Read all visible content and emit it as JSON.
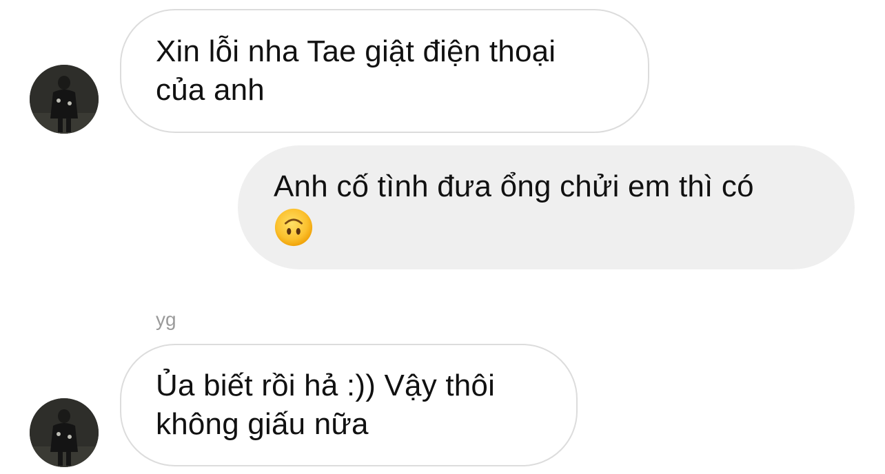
{
  "messages": [
    {
      "direction": "incoming",
      "lines": [
        "Xin lỗi nha Tae giật điện thoại",
        "của anh"
      ],
      "avatar_icon": "profile-photo-person-black-jacket"
    },
    {
      "direction": "outgoing",
      "lines": [
        "Anh cố tình đưa ổng chửi em thì có"
      ],
      "emoji": "upside-down-face"
    },
    {
      "direction": "incoming",
      "sender": "yg",
      "lines": [
        "Ủa biết rồi hả :)) Vậy thôi",
        "không giấu nữa"
      ],
      "avatar_icon": "profile-photo-person-black-jacket"
    }
  ],
  "colors": {
    "incoming_bubble_bg": "#ffffff",
    "incoming_bubble_border": "#dcdcdc",
    "outgoing_bubble_bg": "#efefef",
    "sender_label": "#9a9a9a",
    "text": "#111111"
  }
}
